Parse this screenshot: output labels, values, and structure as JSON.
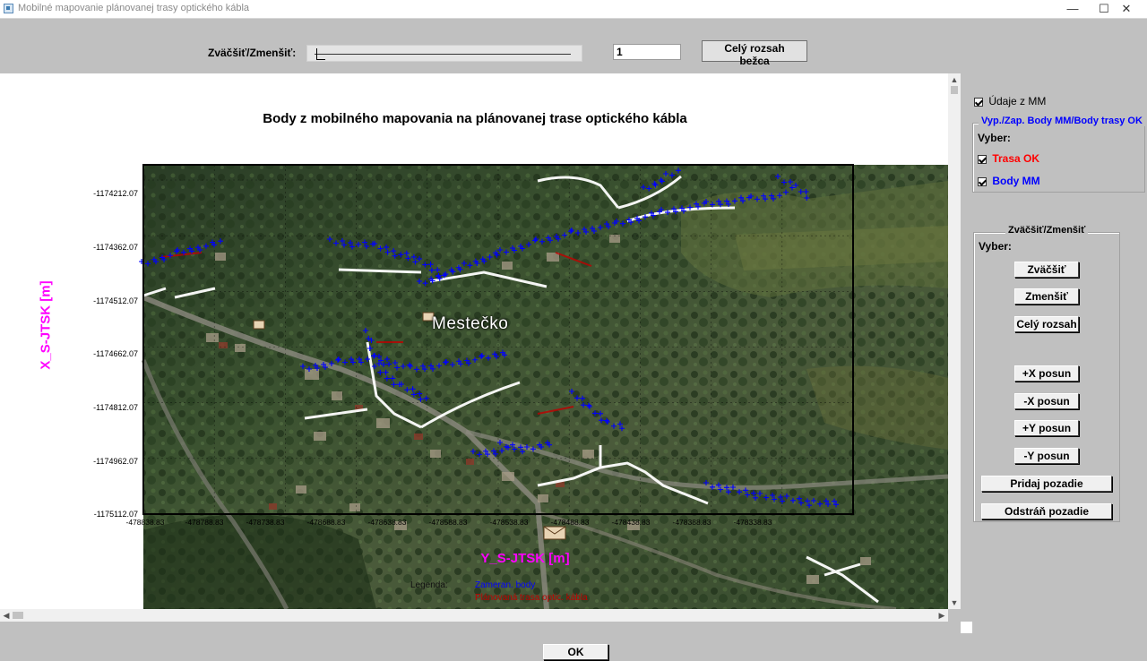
{
  "window": {
    "title": "Mobilné mapovanie plánovanej trasy optického kábla",
    "minimize": "—",
    "maximize": "☐",
    "close": "✕"
  },
  "toolbar": {
    "zoom_label": "Zväčšiť/Zmenšiť:",
    "zoom_value": "1",
    "full_range_button": "Celý rozsah bežca"
  },
  "plot": {
    "title": "Body z mobilného mapovania na plánovanej trase optického kábla",
    "place_label": "Mestečko",
    "legend_label": "Legenda:",
    "legend_items": [
      {
        "label": "Zameran. body",
        "color": "#0000ff"
      },
      {
        "label": "Plánovaná trasa optic. kábla",
        "color": "#ff0000"
      }
    ]
  },
  "chart_data": {
    "type": "scatter",
    "title": "Body z mobilného mapovania na plánovanej trase optického kábla",
    "xlabel": "Y_S-JTSK [m]",
    "ylabel": "X_S-JTSK [m]",
    "yticks": [
      "-1174212.07",
      "-1174362.07",
      "-1174512.07",
      "-1174662.07",
      "-1174812.07",
      "-1174962.07",
      "-1175112.07"
    ],
    "xticks": [
      "-478838.83",
      "-478788.83",
      "-478738.83",
      "-478688.83",
      "-478638.83",
      "-478588.83",
      "-478538.83",
      "-478488.83",
      "-478438.83",
      "-478388.83",
      "-478338.83"
    ],
    "grid": true,
    "series": [
      {
        "name": "Zameran. body",
        "color": "#0000ff"
      },
      {
        "name": "Plánovaná trasa optic. kábla",
        "color": "#ff0000"
      }
    ]
  },
  "right_panel": {
    "udaje_checkbox": "Údaje z MM",
    "group1_title": "Vyp./Zap. Body MM/Body trasy OK",
    "vyber1": "Vyber:",
    "trasa_ok": "Trasa OK",
    "body_mm": "Body MM",
    "trasa_color": "#ff0000",
    "body_color": "#0000ff",
    "link_color": "#0000ff",
    "group2_title": "Zväčšiť/Zmenšiť",
    "vyber2": "Vyber:",
    "zvacsit": "Zväčšiť",
    "zmensit": "Zmenšiť",
    "cely_rozsah": "Celý rozsah",
    "plus_x": "+X posun",
    "minus_x": "-X posun",
    "plus_y": "+Y posun",
    "minus_y": "-Y posun",
    "pridaj": "Pridaj pozadie",
    "odstran": "Odstráň pozadie"
  },
  "footer": {
    "ok": "OK"
  }
}
